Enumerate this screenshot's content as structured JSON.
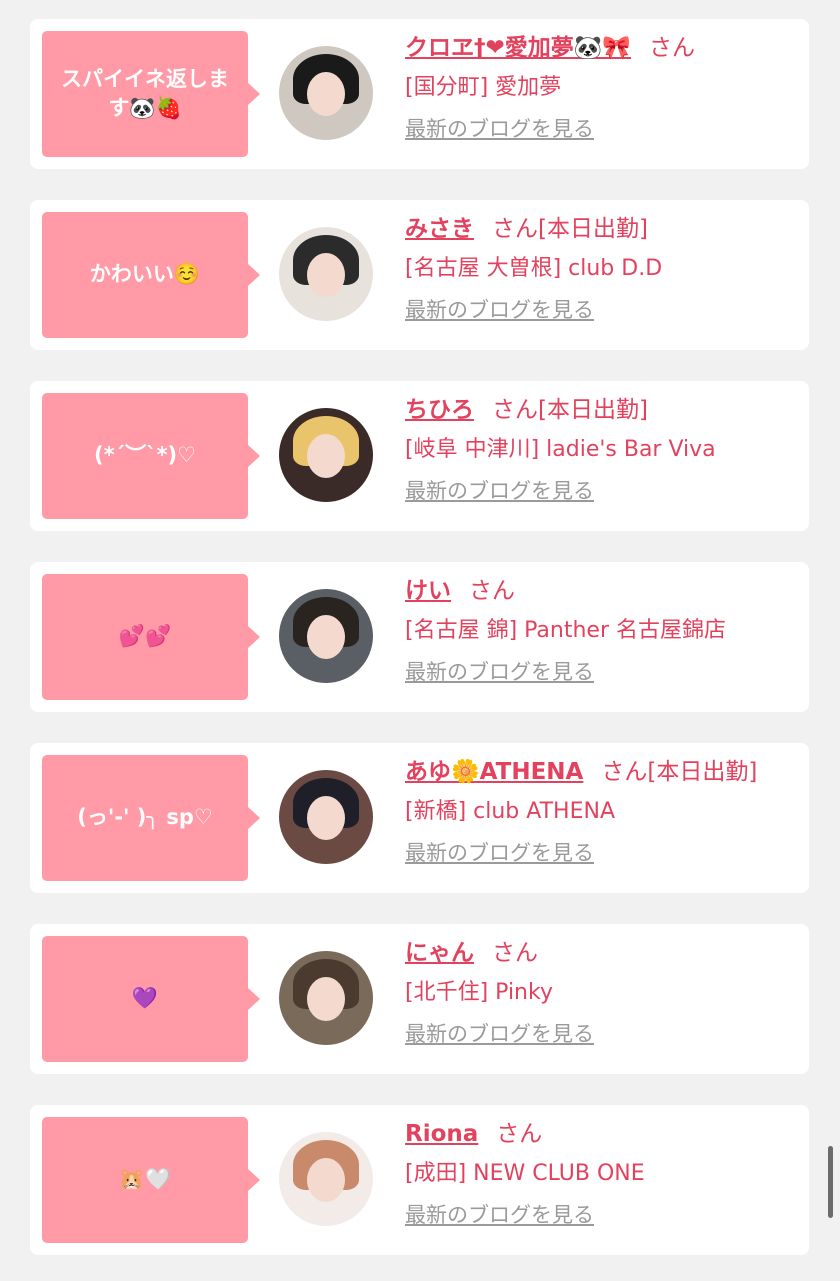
{
  "blog_link_label": "最新のブログを見る",
  "entries": [
    {
      "bubble": "スパイイネ返します🐼🍓",
      "name": "クロヱ†❤愛加夢🐼🎀",
      "san": "さん",
      "status": "",
      "shop": "[国分町] 愛加夢",
      "hair_color": "#1a1a1a",
      "bg_color": "#cfc8c0"
    },
    {
      "bubble": "かわいい☺️",
      "name": "みさき",
      "san": "さん",
      "status": "[本日出勤]",
      "shop": "[名古屋 大曽根] club D.D",
      "hair_color": "#2b2b2b",
      "bg_color": "#e8e2dc"
    },
    {
      "bubble": "(*´︶`*)♡",
      "name": "ちひろ",
      "san": "さん",
      "status": "[本日出勤]",
      "shop": "[岐阜 中津川] ladie's Bar Viva",
      "hair_color": "#e9c46a",
      "bg_color": "#3a2a28"
    },
    {
      "bubble": "💕💕",
      "name": "けい",
      "san": "さん",
      "status": "",
      "shop": "[名古屋 錦] Panther 名古屋錦店",
      "hair_color": "#2a2420",
      "bg_color": "#5a5f66"
    },
    {
      "bubble": "(っ'-' )╮ sp♡",
      "name": "あゆ🌼ATHENA",
      "san": "さん",
      "status": "[本日出勤]",
      "shop": "[新橋] club ATHENA",
      "hair_color": "#1f1f2a",
      "bg_color": "#6b4a44"
    },
    {
      "bubble": "💜",
      "name": "にゃん",
      "san": "さん",
      "status": "",
      "shop": "[北千住] Pinky",
      "hair_color": "#4a3a30",
      "bg_color": "#7a6a5a"
    },
    {
      "bubble": "🐹🤍",
      "name": "Riona",
      "san": "さん",
      "status": "",
      "shop": "[成田] NEW CLUB ONE",
      "hair_color": "#c88a6a",
      "bg_color": "#f2ebe8"
    }
  ]
}
